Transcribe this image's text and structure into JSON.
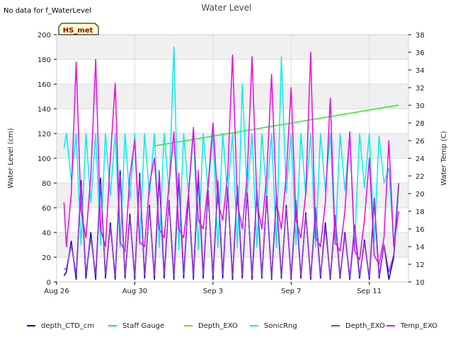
{
  "header": {
    "no_data_note": "No data for f_WaterLevel"
  },
  "chart_data": {
    "type": "line",
    "title": "Water Level",
    "xlabel": "",
    "ylabel": "Water Level (cm)",
    "y2label": "Water Temp (C)",
    "xlim": [
      "2024-08-26",
      "2024-09-13"
    ],
    "ylim": [
      0,
      200
    ],
    "y2lim": [
      10,
      38
    ],
    "x_ticks": [
      {
        "label": "Aug 26",
        "date": "2024-08-26"
      },
      {
        "label": "Aug 30",
        "date": "2024-08-30"
      },
      {
        "label": "Sep 3",
        "date": "2024-09-03"
      },
      {
        "label": "Sep 7",
        "date": "2024-09-07"
      },
      {
        "label": "Sep 11",
        "date": "2024-09-11"
      }
    ],
    "y_ticks": [
      0,
      20,
      40,
      60,
      80,
      100,
      120,
      140,
      160,
      180,
      200
    ],
    "y2_ticks": [
      10,
      12,
      14,
      16,
      18,
      20,
      22,
      24,
      26,
      28,
      30,
      32,
      34,
      36,
      38
    ],
    "grid": true,
    "legend_position": "bottom",
    "annotation": "HS_met",
    "series": [
      {
        "name": "depth_CTD_cm",
        "color": "#0000cc",
        "axis": "left",
        "x": [
          "2024-08-26 09:00",
          "2024-08-26 12:00",
          "2024-08-26 18:00",
          "2024-08-27 00:00",
          "2024-08-27 06:00",
          "2024-08-27 12:00",
          "2024-08-27 18:00",
          "2024-08-28 00:00",
          "2024-08-28 06:00",
          "2024-08-28 12:00",
          "2024-08-28 18:00",
          "2024-08-29 00:00",
          "2024-08-29 06:00",
          "2024-08-29 12:00",
          "2024-08-29 18:00",
          "2024-08-30 00:00",
          "2024-08-30 06:00",
          "2024-08-30 12:00",
          "2024-08-30 18:00",
          "2024-08-31 00:00",
          "2024-08-31 06:00",
          "2024-08-31 12:00",
          "2024-08-31 18:00",
          "2024-09-01 00:00",
          "2024-09-01 06:00",
          "2024-09-01 12:00",
          "2024-09-01 18:00",
          "2024-09-02 00:00",
          "2024-09-02 06:00",
          "2024-09-02 12:00",
          "2024-09-02 18:00",
          "2024-09-03 00:00",
          "2024-09-03 06:00",
          "2024-09-03 12:00",
          "2024-09-03 18:00",
          "2024-09-04 00:00",
          "2024-09-04 06:00",
          "2024-09-04 12:00",
          "2024-09-04 18:00",
          "2024-09-05 00:00",
          "2024-09-05 06:00",
          "2024-09-05 12:00",
          "2024-09-05 18:00",
          "2024-09-06 00:00",
          "2024-09-06 06:00",
          "2024-09-06 12:00",
          "2024-09-06 18:00",
          "2024-09-07 00:00",
          "2024-09-07 06:00",
          "2024-09-07 12:00",
          "2024-09-07 18:00",
          "2024-09-08 00:00",
          "2024-09-08 06:00",
          "2024-09-08 12:00",
          "2024-09-08 18:00",
          "2024-09-09 00:00",
          "2024-09-09 06:00",
          "2024-09-09 12:00",
          "2024-09-09 18:00",
          "2024-09-10 00:00",
          "2024-09-10 06:00",
          "2024-09-10 12:00",
          "2024-09-10 18:00",
          "2024-09-11 00:00",
          "2024-09-11 06:00",
          "2024-09-11 12:00",
          "2024-09-11 18:00",
          "2024-09-12 00:00",
          "2024-09-12 06:00",
          "2024-09-12 12:00"
        ],
        "values": [
          5,
          8,
          33,
          2,
          82,
          3,
          40,
          2,
          84,
          3,
          48,
          2,
          90,
          3,
          55,
          2,
          88,
          3,
          62,
          2,
          86,
          3,
          66,
          2,
          84,
          3,
          70,
          2,
          86,
          3,
          74,
          2,
          80,
          3,
          76,
          2,
          76,
          3,
          74,
          2,
          72,
          3,
          70,
          2,
          68,
          3,
          62,
          2,
          64,
          3,
          56,
          2,
          58,
          3,
          48,
          2,
          52,
          3,
          40,
          2,
          44,
          3,
          34,
          2,
          66,
          3,
          30,
          2,
          20,
          78
        ]
      },
      {
        "name": "Staff Gauge",
        "color": "#22ee22",
        "axis": "left",
        "x": [
          "2024-08-31 00:00",
          "2024-09-12 12:00"
        ],
        "values": [
          110,
          143
        ]
      },
      {
        "name": "Depth_EXO",
        "color": "#ff9900",
        "axis": "left",
        "x": [],
        "values": []
      },
      {
        "name": "SonicRng",
        "color": "#00eeee",
        "axis": "left",
        "x": [
          "2024-08-26 09:00",
          "2024-08-26 12:00",
          "2024-08-26 18:00",
          "2024-08-27 00:00",
          "2024-08-27 06:00",
          "2024-08-27 12:00",
          "2024-08-27 18:00",
          "2024-08-28 00:00",
          "2024-08-28 06:00",
          "2024-08-28 12:00",
          "2024-08-28 18:00",
          "2024-08-29 00:00",
          "2024-08-29 06:00",
          "2024-08-29 12:00",
          "2024-08-29 18:00",
          "2024-08-30 00:00",
          "2024-08-30 06:00",
          "2024-08-30 12:00",
          "2024-08-30 18:00",
          "2024-08-31 00:00",
          "2024-08-31 06:00",
          "2024-08-31 12:00",
          "2024-08-31 18:00",
          "2024-09-01 00:00",
          "2024-09-01 06:00",
          "2024-09-01 12:00",
          "2024-09-01 18:00",
          "2024-09-02 00:00",
          "2024-09-02 06:00",
          "2024-09-02 12:00",
          "2024-09-02 18:00",
          "2024-09-03 00:00",
          "2024-09-03 06:00",
          "2024-09-03 12:00",
          "2024-09-03 18:00",
          "2024-09-04 00:00",
          "2024-09-04 06:00",
          "2024-09-04 12:00",
          "2024-09-04 18:00",
          "2024-09-05 00:00",
          "2024-09-05 06:00",
          "2024-09-05 12:00",
          "2024-09-05 18:00",
          "2024-09-06 00:00",
          "2024-09-06 06:00",
          "2024-09-06 12:00",
          "2024-09-06 18:00",
          "2024-09-07 00:00",
          "2024-09-07 06:00",
          "2024-09-07 12:00",
          "2024-09-07 18:00",
          "2024-09-08 00:00",
          "2024-09-08 06:00",
          "2024-09-08 12:00",
          "2024-09-08 18:00",
          "2024-09-09 00:00",
          "2024-09-09 06:00",
          "2024-09-09 12:00",
          "2024-09-09 18:00",
          "2024-09-10 00:00",
          "2024-09-10 06:00",
          "2024-09-10 12:00",
          "2024-09-10 18:00",
          "2024-09-11 00:00",
          "2024-09-11 06:00",
          "2024-09-11 12:00",
          "2024-09-11 18:00",
          "2024-09-12 00:00",
          "2024-09-12 06:00",
          "2024-09-12 12:00"
        ],
        "values": [
          108,
          120,
          82,
          120,
          30,
          120,
          64,
          120,
          30,
          120,
          70,
          120,
          28,
          120,
          66,
          120,
          30,
          120,
          70,
          120,
          28,
          120,
          72,
          190,
          26,
          120,
          70,
          120,
          26,
          120,
          74,
          120,
          28,
          120,
          70,
          120,
          28,
          160,
          72,
          120,
          28,
          120,
          70,
          120,
          28,
          182,
          72,
          120,
          30,
          120,
          70,
          120,
          28,
          120,
          74,
          120,
          30,
          120,
          74,
          120,
          30,
          120,
          76,
          120,
          32,
          118,
          80,
          92,
          30,
          80
        ]
      },
      {
        "name": "Depth_EXO",
        "color": "#9933dd",
        "axis": "left",
        "x": [
          "2024-08-26 09:00",
          "2024-08-26 12:00",
          "2024-08-26 18:00",
          "2024-08-27 00:00",
          "2024-08-27 06:00",
          "2024-08-27 12:00",
          "2024-08-27 18:00",
          "2024-08-28 00:00",
          "2024-08-28 06:00",
          "2024-08-28 12:00",
          "2024-08-28 18:00",
          "2024-08-29 00:00",
          "2024-08-29 06:00",
          "2024-08-29 12:00",
          "2024-08-29 18:00",
          "2024-08-30 00:00",
          "2024-08-30 06:00",
          "2024-08-30 12:00",
          "2024-08-30 18:00",
          "2024-08-31 00:00",
          "2024-08-31 06:00",
          "2024-08-31 12:00",
          "2024-08-31 18:00",
          "2024-09-01 00:00",
          "2024-09-01 06:00",
          "2024-09-01 12:00",
          "2024-09-01 18:00",
          "2024-09-02 00:00",
          "2024-09-02 06:00",
          "2024-09-02 12:00",
          "2024-09-02 18:00",
          "2024-09-03 00:00",
          "2024-09-03 06:00",
          "2024-09-03 12:00",
          "2024-09-03 18:00",
          "2024-09-04 00:00",
          "2024-09-04 06:00",
          "2024-09-04 12:00",
          "2024-09-04 18:00",
          "2024-09-05 00:00",
          "2024-09-05 06:00",
          "2024-09-05 12:00",
          "2024-09-05 18:00",
          "2024-09-06 00:00",
          "2024-09-06 06:00",
          "2024-09-06 12:00",
          "2024-09-06 18:00",
          "2024-09-07 00:00",
          "2024-09-07 06:00",
          "2024-09-07 12:00",
          "2024-09-07 18:00",
          "2024-09-08 00:00",
          "2024-09-08 06:00",
          "2024-09-08 12:00",
          "2024-09-08 18:00",
          "2024-09-09 00:00",
          "2024-09-09 06:00",
          "2024-09-09 12:00",
          "2024-09-09 18:00",
          "2024-09-10 00:00",
          "2024-09-10 06:00",
          "2024-09-10 12:00",
          "2024-09-10 18:00",
          "2024-09-11 00:00",
          "2024-09-11 06:00",
          "2024-09-11 12:00",
          "2024-09-11 18:00",
          "2024-09-12 00:00",
          "2024-09-12 06:00",
          "2024-09-12 12:00"
        ],
        "values": [
          10,
          11,
          30,
          6,
          78,
          7,
          36,
          6,
          80,
          6,
          45,
          5,
          86,
          6,
          52,
          5,
          85,
          6,
          60,
          5,
          90,
          6,
          66,
          5,
          88,
          6,
          70,
          5,
          90,
          6,
          72,
          5,
          82,
          6,
          76,
          5,
          78,
          6,
          72,
          5,
          74,
          5,
          68,
          4,
          70,
          5,
          60,
          4,
          66,
          5,
          54,
          4,
          60,
          5,
          44,
          4,
          54,
          5,
          38,
          4,
          46,
          5,
          32,
          4,
          68,
          5,
          30,
          8,
          22,
          80
        ]
      },
      {
        "name": "Temp_EXO",
        "color": "#ee00ee",
        "axis": "right",
        "x": [
          "2024-08-26 09:00",
          "2024-08-26 12:00",
          "2024-08-26 18:00",
          "2024-08-27 00:00",
          "2024-08-27 06:00",
          "2024-08-27 12:00",
          "2024-08-27 18:00",
          "2024-08-28 00:00",
          "2024-08-28 06:00",
          "2024-08-28 12:00",
          "2024-08-28 18:00",
          "2024-08-29 00:00",
          "2024-08-29 06:00",
          "2024-08-29 12:00",
          "2024-08-29 18:00",
          "2024-08-30 00:00",
          "2024-08-30 06:00",
          "2024-08-30 12:00",
          "2024-08-30 18:00",
          "2024-08-31 00:00",
          "2024-08-31 06:00",
          "2024-08-31 12:00",
          "2024-08-31 18:00",
          "2024-09-01 00:00",
          "2024-09-01 06:00",
          "2024-09-01 12:00",
          "2024-09-01 18:00",
          "2024-09-02 00:00",
          "2024-09-02 06:00",
          "2024-09-02 12:00",
          "2024-09-02 18:00",
          "2024-09-03 00:00",
          "2024-09-03 06:00",
          "2024-09-03 12:00",
          "2024-09-03 18:00",
          "2024-09-04 00:00",
          "2024-09-04 06:00",
          "2024-09-04 12:00",
          "2024-09-04 18:00",
          "2024-09-05 00:00",
          "2024-09-05 06:00",
          "2024-09-05 12:00",
          "2024-09-05 18:00",
          "2024-09-06 00:00",
          "2024-09-06 06:00",
          "2024-09-06 12:00",
          "2024-09-06 18:00",
          "2024-09-07 00:00",
          "2024-09-07 06:00",
          "2024-09-07 12:00",
          "2024-09-07 18:00",
          "2024-09-08 00:00",
          "2024-09-08 06:00",
          "2024-09-08 12:00",
          "2024-09-08 18:00",
          "2024-09-09 00:00",
          "2024-09-09 06:00",
          "2024-09-09 12:00",
          "2024-09-09 18:00",
          "2024-09-10 00:00",
          "2024-09-10 06:00",
          "2024-09-10 12:00",
          "2024-09-10 18:00",
          "2024-09-11 00:00",
          "2024-09-11 06:00",
          "2024-09-11 12:00",
          "2024-09-11 18:00",
          "2024-09-12 00:00",
          "2024-09-12 06:00",
          "2024-09-12 12:00"
        ],
        "values": [
          19,
          14,
          20,
          34.9,
          18,
          15,
          22,
          35.2,
          16,
          14,
          24,
          32.5,
          14.5,
          13.5,
          22,
          26,
          14.5,
          14,
          21,
          24,
          16,
          15,
          21,
          27,
          16,
          15,
          20,
          27.5,
          17,
          16,
          21,
          28,
          19,
          17,
          22,
          35.7,
          19,
          16,
          22,
          35.5,
          19,
          16,
          22,
          33.5,
          19,
          16,
          22,
          32,
          17,
          15,
          20,
          36,
          15,
          14,
          19,
          30.8,
          14.5,
          13.5,
          18,
          27,
          13.5,
          12.5,
          17,
          24,
          13,
          12,
          15,
          26,
          14,
          18
        ]
      }
    ]
  }
}
